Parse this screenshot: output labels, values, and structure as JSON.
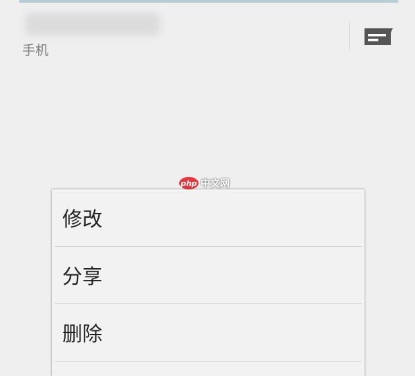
{
  "contact": {
    "type_label": "手机"
  },
  "actions": {
    "message_icon": "message-icon"
  },
  "watermark": {
    "logo_text": "php",
    "site_text": "中文网"
  },
  "context_menu": {
    "items": [
      {
        "label": "修改"
      },
      {
        "label": "分享"
      },
      {
        "label": "删除"
      }
    ]
  }
}
